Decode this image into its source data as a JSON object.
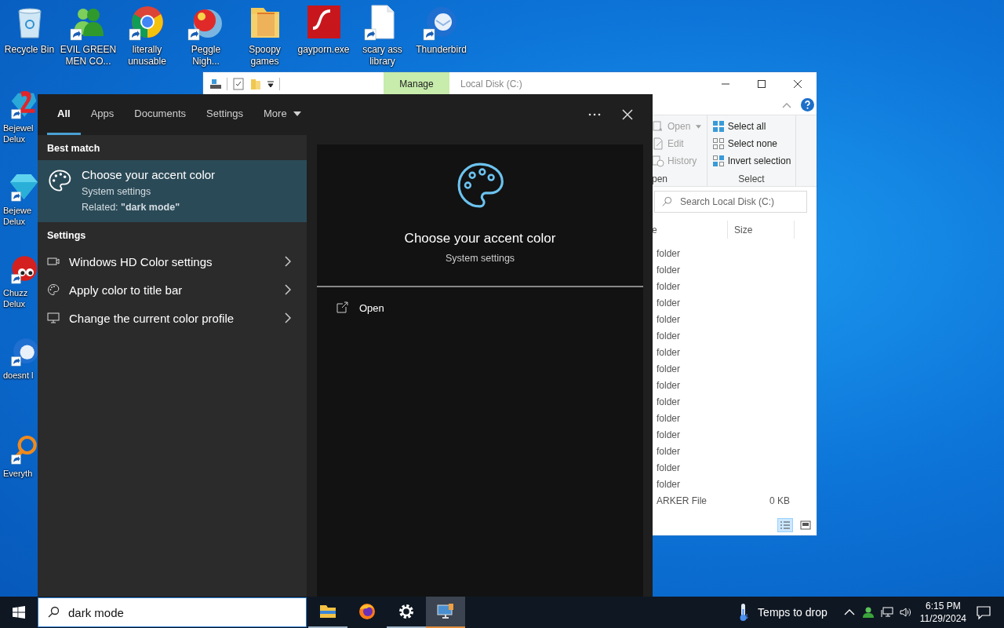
{
  "desktop_top_row": [
    {
      "kind": "bin",
      "shortcut": false,
      "lines": [
        "Recycle Bin"
      ]
    },
    {
      "kind": "people",
      "shortcut": true,
      "lines": [
        "EVIL GREEN",
        "MEN CO..."
      ]
    },
    {
      "kind": "browser",
      "shortcut": true,
      "lines": [
        "literally",
        "unusable"
      ]
    },
    {
      "kind": "ball",
      "shortcut": true,
      "lines": [
        "Peggle",
        "Nigh..."
      ]
    },
    {
      "kind": "folder",
      "shortcut": false,
      "lines": [
        "Spoopy",
        "games"
      ]
    },
    {
      "kind": "flash",
      "shortcut": false,
      "lines": [
        "gayporn.exe"
      ]
    },
    {
      "kind": "document",
      "shortcut": true,
      "lines": [
        "scary ass",
        "library"
      ]
    },
    {
      "kind": "bird",
      "shortcut": true,
      "lines": [
        "Thunderbird"
      ]
    }
  ],
  "desktop_left_column": [
    {
      "kind": "gem2",
      "shortcut": true,
      "lines": [
        "Bejewel",
        "Delux"
      ]
    },
    {
      "kind": "gem",
      "shortcut": true,
      "lines": [
        "Bejewe",
        "Delux"
      ]
    },
    {
      "kind": "fuzz",
      "shortcut": true,
      "lines": [
        "Chuzz",
        "Delux"
      ]
    },
    {
      "kind": "bird",
      "shortcut": true,
      "lines": [
        "doesnt l"
      ]
    },
    {
      "kind": "magnifier",
      "shortcut": true,
      "lines": [
        "Everyth"
      ]
    }
  ],
  "explorer": {
    "ribbon_tab": "Manage",
    "title": "Local Disk (C:)",
    "ribbon_groups": [
      {
        "label": "pen",
        "items": [
          {
            "kind": "open",
            "label": "Open",
            "dropdown": true,
            "disabled": true
          },
          {
            "kind": "edit",
            "label": "Edit",
            "dropdown": false,
            "disabled": true
          },
          {
            "kind": "history",
            "label": "History",
            "dropdown": false,
            "disabled": true
          }
        ]
      },
      {
        "label": "Select",
        "items": [
          {
            "kind": "select-all",
            "label": "Select all",
            "dropdown": false,
            "disabled": false
          },
          {
            "kind": "select-none",
            "label": "Select none",
            "dropdown": false,
            "disabled": false
          },
          {
            "kind": "invert",
            "label": "Invert selection",
            "dropdown": false,
            "disabled": false
          }
        ]
      }
    ],
    "search": {
      "placeholder": "Search Local Disk (C:)"
    },
    "columns": [
      "e",
      "Size"
    ],
    "rows": [
      {
        "cells": [
          "folder"
        ]
      },
      {
        "cells": [
          "folder"
        ]
      },
      {
        "cells": [
          "folder"
        ]
      },
      {
        "cells": [
          "folder"
        ]
      },
      {
        "cells": [
          "folder"
        ]
      },
      {
        "cells": [
          "folder"
        ]
      },
      {
        "cells": [
          "folder"
        ]
      },
      {
        "cells": [
          "folder"
        ]
      },
      {
        "cells": [
          "folder"
        ]
      },
      {
        "cells": [
          "folder"
        ]
      },
      {
        "cells": [
          "folder"
        ]
      },
      {
        "cells": [
          "folder"
        ]
      },
      {
        "cells": [
          "folder"
        ]
      },
      {
        "cells": [
          "folder"
        ]
      },
      {
        "cells": [
          "folder"
        ]
      },
      {
        "cells": [
          "ARKER File",
          "0 KB"
        ]
      }
    ]
  },
  "search_panel": {
    "tabs": [
      {
        "label": "All",
        "selected": true,
        "dropdown": false
      },
      {
        "label": "Apps",
        "selected": false,
        "dropdown": false
      },
      {
        "label": "Documents",
        "selected": false,
        "dropdown": false
      },
      {
        "label": "Settings",
        "selected": false,
        "dropdown": false
      },
      {
        "label": "More",
        "selected": false,
        "dropdown": true
      }
    ],
    "best_match": {
      "heading": "Best match",
      "title": "Choose your accent color",
      "subtitle": "System settings",
      "related": "Related: **\"dark mode\"**",
      "selected": true
    },
    "settings": {
      "heading": "Settings",
      "items": [
        {
          "kind": "display",
          "label": "Windows HD Color settings"
        },
        {
          "kind": "palette",
          "label": "Apply color to title bar"
        },
        {
          "kind": "monitor",
          "label": "Change the current color profile"
        }
      ]
    },
    "preview": {
      "title": "Choose your accent color",
      "subtitle": "System settings",
      "actions": [
        {
          "label": "Open"
        }
      ]
    }
  },
  "taskbar": {
    "search": {
      "value": "dark mode"
    },
    "pinned": [
      {
        "kind": "explorer",
        "running": true,
        "active": false
      },
      {
        "kind": "firefox",
        "running": false,
        "active": false
      },
      {
        "kind": "settings",
        "running": true,
        "active": false
      },
      {
        "kind": "remote",
        "running": true,
        "active": true
      }
    ],
    "weather": "Temps to drop",
    "time": "6:15 PM",
    "date": "11/29/2024"
  }
}
